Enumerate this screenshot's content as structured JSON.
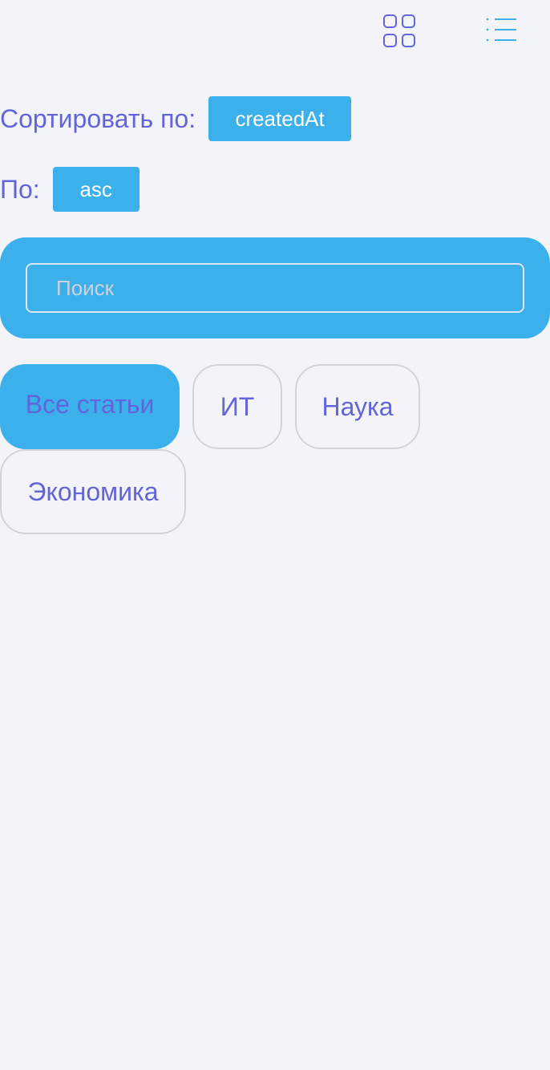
{
  "view_switcher": {
    "grid_icon": "grid-icon",
    "list_icon": "list-icon"
  },
  "sort": {
    "field_label": "Сортировать по:",
    "field_value": "createdAt",
    "order_label": "По:",
    "order_value": "asc"
  },
  "search": {
    "placeholder": "Поиск",
    "value": ""
  },
  "tabs": [
    {
      "label": "Все статьи",
      "active": true
    },
    {
      "label": "ИТ",
      "active": false
    },
    {
      "label": "Наука",
      "active": false
    },
    {
      "label": "Экономика",
      "active": false
    }
  ],
  "colors": {
    "accent": "#3bb0ea",
    "text": "#6364d9",
    "background": "#f3f4fa",
    "tab_border": "#d3d3da"
  }
}
